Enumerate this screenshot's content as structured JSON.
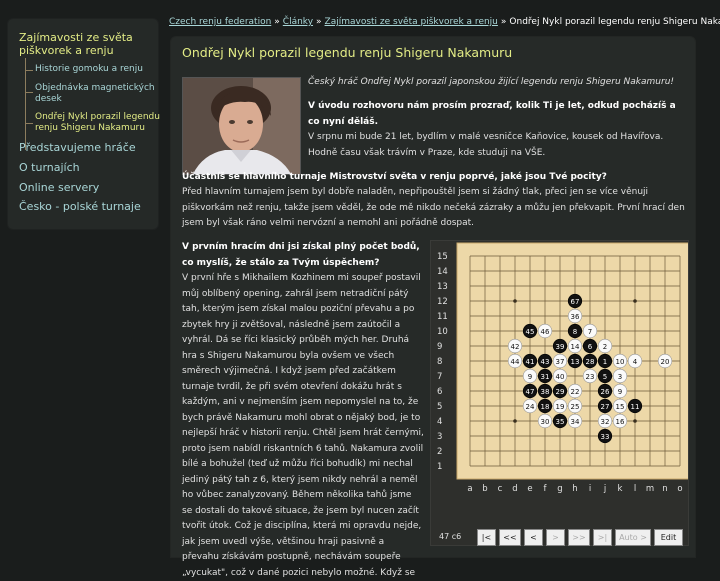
{
  "sidebar": {
    "section_title": "Zajímavosti ze světa piškvorek a renju",
    "sub_items": [
      {
        "label": "Historie gomoku a renju"
      },
      {
        "label": "Objednávka magnetických desek"
      },
      {
        "label": "Ondřej Nykl porazil legendu renju Shigeru Nakamuru"
      }
    ],
    "main_items": [
      {
        "label": "Představujeme hráče"
      },
      {
        "label": "O turnajích"
      },
      {
        "label": "Online servery"
      },
      {
        "label": "Česko - polské turnaje"
      }
    ]
  },
  "breadcrumb": {
    "items": [
      "Czech renju federation",
      "Články",
      "Zajímavosti ze světa piškvorek a renju"
    ],
    "current": "Ondřej Nykl porazil legendu renju Shigeru Nakamuru",
    "separator": "»"
  },
  "article": {
    "title": "Ondřej Nykl porazil legendu renju Shigeru Nakamuru",
    "intro": "Český hráč Ondřej Nykl porazil japonskou žijící legendu renju Shigeru Nakamuru!",
    "q1": "V úvodu rozhovoru nám prosím prozraď, kolik Ti je let, odkud pocházíš a co nyní děláš.",
    "a1": "V srpnu mi bude 21 let, bydlím v malé vesničce Kaňovice, kousek od Havířova. Hodně času však trávím v Praze, kde studuji na VŠE.",
    "q2": "Účastníš se hlavního turnaje Mistrovství světa v renju poprvé, jaké jsou Tvé pocity?",
    "a2": "Před hlavním turnajem jsem byl dobře naladěn, nepřipouštěl jsem si žádný tlak, přeci jen se více věnuji piškvorkám než renju, takže jsem věděl, že ode mě nikdo nečeká zázraky a můžu jen překvapit. První hrací den jsem byl však ráno velmi nervózní a nemohl ani pořádně dospat.",
    "q3": "V prvním hracím dni jsi získal plný počet bodů, co myslíš, že stálo za Tvým úspěchem?",
    "a3": "V první hře s Mikhailem Kozhinem mi soupeř postavil můj oblíbený opening, zahrál jsem netradiční pátý tah, kterým jsem získal malou poziční převahu a po zbytek hry ji zvětšoval, následně jsem zaútočil a vyhrál. Dá se říci klasický průběh mých her. Druhá hra s Shigeru Nakamurou byla ovšem ve všech směrech výjimečná. I když jsem před začátkem turnaje tvrdil, že při svém otevření dokážu hrát s každým, ani v nejmenším jsem nepomyslel na to, že bych právě Nakamuru mohl obrat o nějaký bod, je to nejlepší hráč v historii renju. Chtěl jsem hrát černými, proto jsem nabídl riskantních 6 tahů. Nakamura zvolil bílé a bohužel (teď už můžu říci bohudík) mi nechal jediný pátý tah z 6, který jsem nikdy nehrál a neměl ho vůbec zanalyzovaný. Během několika tahů jsme se dostali do takové situace, že jsem byl nucen začít tvořit útok. Což je disciplína, která mi opravdu nejde, jak jsem uvedl výše, většinou hraji pasivně a převahu získávám postupně, nechávám soupeře „vycukat\", což v dané pozici nebylo možné. Když se"
  },
  "board": {
    "size": 15,
    "row_labels": [
      "15",
      "14",
      "13",
      "12",
      "11",
      "10",
      "9",
      "8",
      "7",
      "6",
      "5",
      "4",
      "3",
      "2",
      "1"
    ],
    "col_labels": [
      "a",
      "b",
      "c",
      "d",
      "e",
      "f",
      "g",
      "h",
      "i",
      "j",
      "k",
      "l",
      "m",
      "n",
      "o"
    ],
    "stones": [
      {
        "c": "h",
        "r": 12,
        "color": "black",
        "n": "67"
      },
      {
        "c": "h",
        "r": 11,
        "color": "white",
        "n": "36"
      },
      {
        "c": "e",
        "r": 10,
        "color": "black",
        "n": "45"
      },
      {
        "c": "f",
        "r": 10,
        "color": "white",
        "n": "46"
      },
      {
        "c": "h",
        "r": 10,
        "color": "black",
        "n": "8"
      },
      {
        "c": "i",
        "r": 10,
        "color": "white",
        "n": "7"
      },
      {
        "c": "d",
        "r": 9,
        "color": "white",
        "n": "42"
      },
      {
        "c": "g",
        "r": 9,
        "color": "black",
        "n": "39"
      },
      {
        "c": "h",
        "r": 9,
        "color": "white",
        "n": "14"
      },
      {
        "c": "i",
        "r": 9,
        "color": "black",
        "n": "6"
      },
      {
        "c": "j",
        "r": 9,
        "color": "white",
        "n": "2"
      },
      {
        "c": "d",
        "r": 8,
        "color": "white",
        "n": "44"
      },
      {
        "c": "e",
        "r": 8,
        "color": "black",
        "n": "41"
      },
      {
        "c": "f",
        "r": 8,
        "color": "black",
        "n": "43"
      },
      {
        "c": "g",
        "r": 8,
        "color": "white",
        "n": "37"
      },
      {
        "c": "h",
        "r": 8,
        "color": "black",
        "n": "13"
      },
      {
        "c": "i",
        "r": 8,
        "color": "black",
        "n": "28"
      },
      {
        "c": "j",
        "r": 8,
        "color": "black",
        "n": "1"
      },
      {
        "c": "k",
        "r": 8,
        "color": "white",
        "n": "10"
      },
      {
        "c": "l",
        "r": 8,
        "color": "white",
        "n": "4"
      },
      {
        "c": "n",
        "r": 8,
        "color": "white",
        "n": "20"
      },
      {
        "c": "e",
        "r": 7,
        "color": "white",
        "n": "9"
      },
      {
        "c": "f",
        "r": 7,
        "color": "black",
        "n": "31"
      },
      {
        "c": "g",
        "r": 7,
        "color": "white",
        "n": "40"
      },
      {
        "c": "i",
        "r": 7,
        "color": "white",
        "n": "23"
      },
      {
        "c": "j",
        "r": 7,
        "color": "black",
        "n": "5"
      },
      {
        "c": "k",
        "r": 7,
        "color": "white",
        "n": "3"
      },
      {
        "c": "e",
        "r": 6,
        "color": "black",
        "n": "47"
      },
      {
        "c": "f",
        "r": 6,
        "color": "black",
        "n": "38"
      },
      {
        "c": "g",
        "r": 6,
        "color": "black",
        "n": "29"
      },
      {
        "c": "h",
        "r": 6,
        "color": "white",
        "n": "22"
      },
      {
        "c": "j",
        "r": 6,
        "color": "black",
        "n": "26"
      },
      {
        "c": "k",
        "r": 6,
        "color": "white",
        "n": "9"
      },
      {
        "c": "e",
        "r": 5,
        "color": "white",
        "n": "24"
      },
      {
        "c": "f",
        "r": 5,
        "color": "black",
        "n": "18"
      },
      {
        "c": "g",
        "r": 5,
        "color": "white",
        "n": "19"
      },
      {
        "c": "h",
        "r": 5,
        "color": "white",
        "n": "25"
      },
      {
        "c": "j",
        "r": 5,
        "color": "black",
        "n": "27"
      },
      {
        "c": "k",
        "r": 5,
        "color": "white",
        "n": "15"
      },
      {
        "c": "l",
        "r": 5,
        "color": "black",
        "n": "11"
      },
      {
        "c": "f",
        "r": 4,
        "color": "white",
        "n": "30"
      },
      {
        "c": "g",
        "r": 4,
        "color": "black",
        "n": "35"
      },
      {
        "c": "h",
        "r": 4,
        "color": "white",
        "n": "34"
      },
      {
        "c": "j",
        "r": 4,
        "color": "white",
        "n": "32"
      },
      {
        "c": "k",
        "r": 4,
        "color": "white",
        "n": "16"
      },
      {
        "c": "j",
        "r": 3,
        "color": "black",
        "n": "33"
      }
    ],
    "star_points": [
      {
        "c": "d",
        "r": 12
      },
      {
        "c": "l",
        "r": 12
      },
      {
        "c": "h",
        "r": 8
      },
      {
        "c": "d",
        "r": 4
      },
      {
        "c": "l",
        "r": 4
      }
    ],
    "move_counter": "47  c6",
    "controls": [
      {
        "label": "|<",
        "enabled": true
      },
      {
        "label": "<<",
        "enabled": true
      },
      {
        "label": "<",
        "enabled": true
      },
      {
        "label": ">",
        "enabled": false
      },
      {
        "label": ">>",
        "enabled": false
      },
      {
        "label": ">|",
        "enabled": false
      },
      {
        "label": "Auto >",
        "enabled": false
      },
      {
        "label": "Edit",
        "enabled": true
      }
    ]
  },
  "colors": {
    "accent_yellow": "#e3ec86",
    "link_cyan": "#a9d6d7",
    "background": "#1a1d1c",
    "panel": "#262a28",
    "board": "#edd8a8"
  }
}
